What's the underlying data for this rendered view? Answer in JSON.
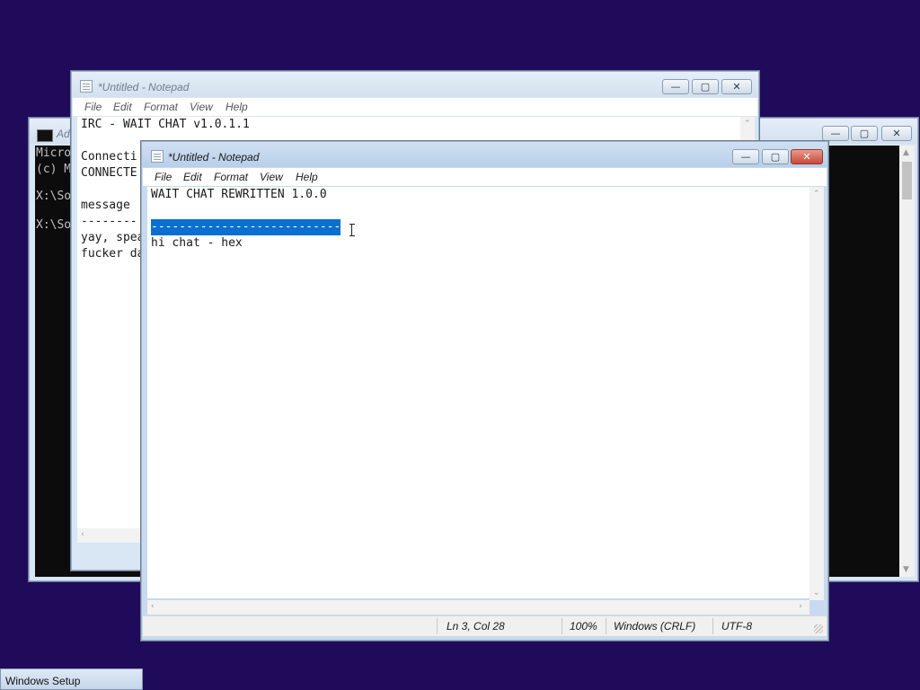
{
  "console_window": {
    "title": "Ad",
    "lines": [
      "Micro",
      "(c) M",
      "",
      "X:\\So",
      "",
      "X:\\So"
    ]
  },
  "back_notepad": {
    "title": "*Untitled - Notepad",
    "menu": [
      "File",
      "Edit",
      "Format",
      "View",
      "Help"
    ],
    "lines": [
      "IRC - WAIT CHAT v1.0.1.1",
      "",
      "Connecti",
      "CONNECTE",
      "",
      "message",
      "--------",
      "yay, spea",
      "fucker da"
    ]
  },
  "front_notepad": {
    "title": "*Untitled - Notepad",
    "menu": [
      "File",
      "Edit",
      "Format",
      "View",
      "Help"
    ],
    "lines": [
      "WAIT CHAT REWRITTEN 1.0.0",
      "",
      "---------------------------",
      "hi chat - hex"
    ],
    "status": {
      "position": "Ln 3, Col 28",
      "zoom": "100%",
      "line_ending": "Windows (CRLF)",
      "encoding": "UTF-8"
    }
  },
  "window_controls": {
    "minimize": "—",
    "maximize": "▢",
    "close": "✕"
  },
  "taskbar": {
    "item_label": "Windows Setup"
  },
  "colors": {
    "desktop": "#200a5a",
    "selection": "#0a6fd0"
  }
}
